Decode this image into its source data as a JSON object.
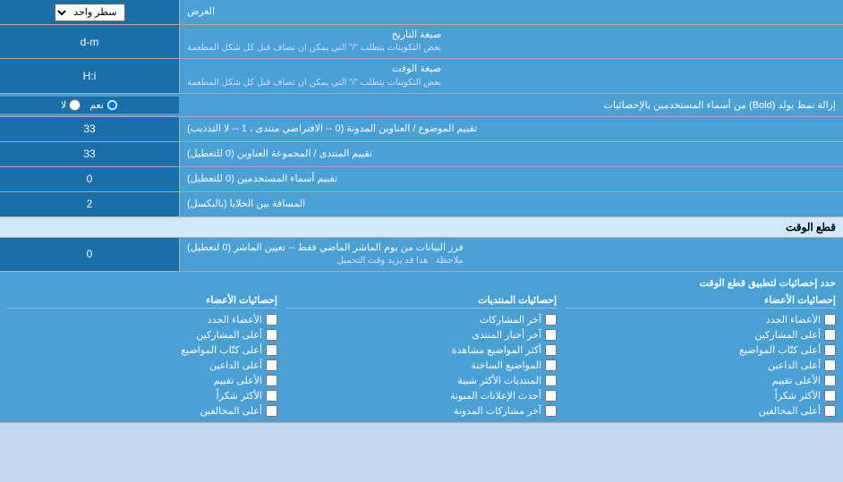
{
  "page": {
    "title": "العرض"
  },
  "rows": [
    {
      "id": "single-line",
      "label": "العرض",
      "input_type": "dropdown",
      "value": "سطر واحد"
    },
    {
      "id": "date-format",
      "label": "صيغة التاريخ",
      "sublabel": "بعض التكوينات يتطلب \"/\" التي يمكن ان تضاف قبل كل شكل المطعمة",
      "input_type": "text",
      "value": "d-m"
    },
    {
      "id": "time-format",
      "label": "صيغة الوقت",
      "sublabel": "بعض التكوينات يتطلب \"/\" التي يمكن ان تضاف قبل كل شكل المطعمة",
      "input_type": "text",
      "value": "H:i"
    },
    {
      "id": "bold-remove",
      "label": "إزالة نمط بولد (Bold) من أسماء المستخدمين بالإحصائيات",
      "input_type": "radio",
      "options": [
        "نعم",
        "لا"
      ],
      "selected": "نعم"
    },
    {
      "id": "subject-sort",
      "label": "تقييم الموضوع / العناوين المدونة (0 -- الافتراضي منتدى ، 1 -- لا التذذيب)",
      "input_type": "text",
      "value": "33"
    },
    {
      "id": "forum-sort",
      "label": "تقييم المنتدى / المجموعة العناوين (0 للتعطيل)",
      "input_type": "text",
      "value": "33"
    },
    {
      "id": "users-sort",
      "label": "تقييم أسماء المستخدمين (0 للتعطيل)",
      "input_type": "text",
      "value": "0"
    },
    {
      "id": "cell-spacing",
      "label": "المسافة بين الخلايا (بالبكسل)",
      "input_type": "text",
      "value": "2"
    }
  ],
  "time_cutoff": {
    "section_title": "قطع الوقت",
    "row_label": "فرز البيانات من يوم الماشر الماضي فقط -- تعيين الماشر (0 لتعطيل)",
    "row_sublabel": "ملاحظة : هذا قد يزيد وقت التحميل",
    "row_value": "0",
    "apply_label": "حدد إحصائيات لتطبيق قطع الوقت"
  },
  "checkboxes": {
    "col1_header": "إحصائيات الأعضاء",
    "col1_items": [
      "الأعضاء الجدد",
      "أعلى المشاركين",
      "أعلى كتّاب المواضيع",
      "أعلى الداعين",
      "الأعلى تقييم",
      "الأكثر شكراً",
      "أعلى المخالفين"
    ],
    "col2_header": "إحصائيات المنتديات",
    "col2_items": [
      "آخر المشاركات",
      "آخر أخبار المنتدى",
      "أكثر المواضيع مشاهدة",
      "المواضيع الساخنة",
      "المنتديات الأكثر شبية",
      "أحدث الإعلانات المبونة",
      "آخر مشاركات المدونة"
    ],
    "col3_header": "إحصائيات الأعضاء",
    "col3_items": [
      "الأعضاء الجدد",
      "أعلى المشاركين",
      "أعلى كتّاب المواضيع",
      "أعلى الداعين",
      "الأعلى تقييم",
      "الأكثر شكراً",
      "أعلى المخالفين"
    ]
  },
  "labels": {
    "single_line": "سطر واحد",
    "yes": "نعم",
    "no": "لا"
  }
}
